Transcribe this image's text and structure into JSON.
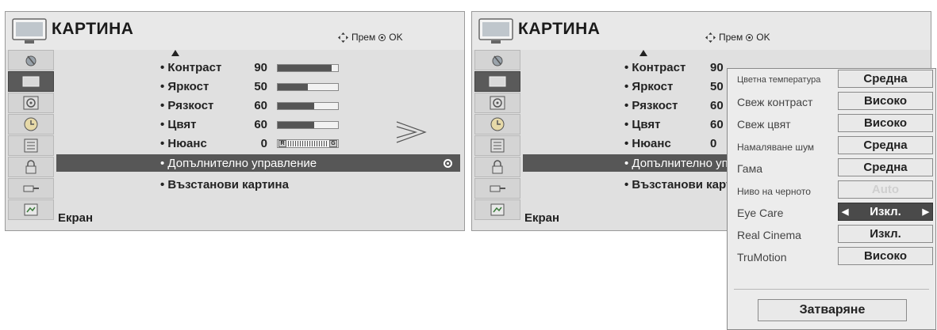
{
  "title": "КАРТИНА",
  "nav_hint": {
    "move_label": "Прем",
    "ok_label": "OK"
  },
  "sidebar_icons": [
    "satellite-icon",
    "picture-icon",
    "speaker-icon",
    "clock-icon",
    "settings-icon",
    "lock-icon",
    "input-icon",
    "usb-icon"
  ],
  "menu_items": [
    {
      "label": "• Контраст",
      "value": "90",
      "level": 0.9
    },
    {
      "label": "• Яркост",
      "value": "50",
      "level": 0.5
    },
    {
      "label": "• Рязкост",
      "value": "60",
      "level": 0.6
    },
    {
      "label": "• Цвят",
      "value": "60",
      "level": 0.6
    },
    {
      "label": "• Нюанс",
      "value": "0",
      "tint_r": "R",
      "tint_g": "G"
    },
    {
      "label": "• Допълнително управление"
    },
    {
      "label": "• Възстанови картина"
    }
  ],
  "footer_label": "Екран",
  "popup": {
    "rows": [
      {
        "label": "Цветна температура",
        "value": "Средна"
      },
      {
        "label": "Свеж контраст",
        "value": "Високо"
      },
      {
        "label": "Свеж цвят",
        "value": "Високо"
      },
      {
        "label": "Намаляване шум",
        "value": "Средна"
      },
      {
        "label": "Гама",
        "value": "Средна"
      },
      {
        "label": "Ниво на черното",
        "value": "Auto"
      },
      {
        "label": "Eye Care",
        "value": "Изкл."
      },
      {
        "label": "Real Cinema",
        "value": "Изкл."
      },
      {
        "label": "TruMotion",
        "value": "Високо"
      }
    ],
    "close_label": "Затваряне"
  },
  "colors": {
    "panel_bg": "#e0e0e0",
    "highlight": "#575757",
    "bar_fill": "#555555"
  }
}
